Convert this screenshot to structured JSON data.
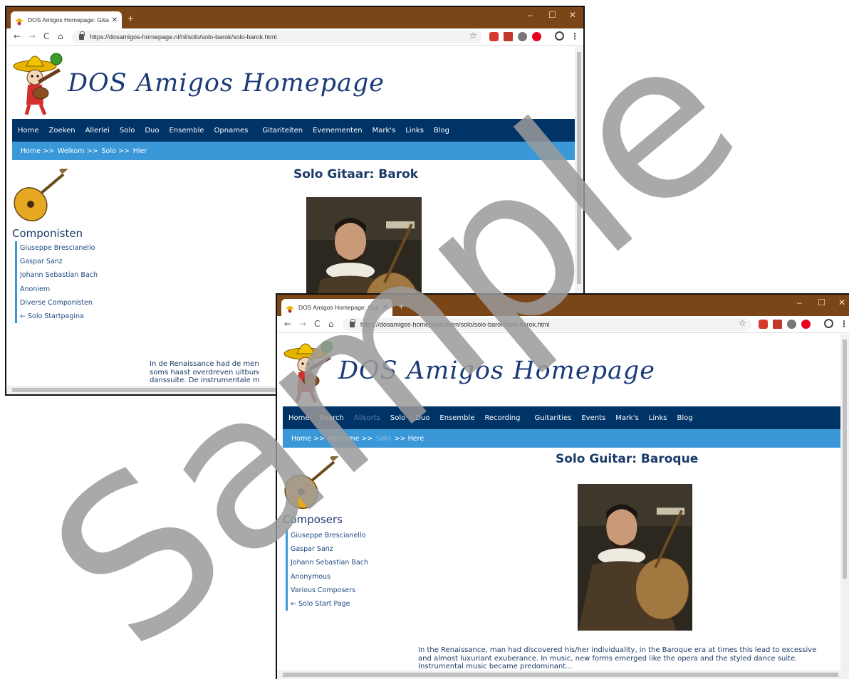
{
  "browser_nl": {
    "tab_title": "DOS Amigos Homepage: Gitaar",
    "tab_close": "✕",
    "new_tab": "+",
    "url": "https://dosamigos-homepage.nl/nl/solo/solo-barok/solo-barok.html"
  },
  "browser_en": {
    "tab_title": "DOS Amigos Homepage: Guitar",
    "tab_close": "✕",
    "new_tab": "+",
    "url": "https://dosamigos-homepage.nl/en/solo/solo-barok/solo-barok.html"
  },
  "window_controls": {
    "minimize": "–",
    "maximize": "☐",
    "close": "✕"
  },
  "toolbar_glyphs": {
    "back": "←",
    "forward": "→",
    "reload": "C",
    "home": "⌂",
    "star": "☆",
    "menu": "⋮"
  },
  "site_title": "DOS Amigos Homepage",
  "page_nl": {
    "nav": [
      "Home",
      "Zoeken",
      "Allerlei",
      "Solo",
      "Duo",
      "Ensemble",
      "Opnames",
      "Gitariteiten",
      "Evenementen",
      "Mark's",
      "Links",
      "Blog"
    ],
    "breadcrumb": [
      "Home >>",
      "Welkom >>",
      "Solo >>",
      "Hier"
    ],
    "heading": "Solo Gitaar: Barok",
    "side_heading": "Componisten",
    "side_links": [
      "Giuseppe Brescianello",
      "Gaspar Sanz",
      "Johann Sebastian Bach",
      "Anoniem",
      "Diverse Componisten",
      "← Solo Startpagina"
    ],
    "body_lines": [
      "In de Renaissance had de mens zie",
      "soms haast overdreven uitbundigh",
      "danssuite. De instrumentale muzie"
    ]
  },
  "page_en": {
    "nav": [
      "Home",
      "Search",
      "Allsorts",
      "Solo",
      "Duo",
      "Ensemble",
      "Recording",
      "Guitarities",
      "Events",
      "Mark's",
      "Links",
      "Blog"
    ],
    "breadcrumb": [
      "Home >>",
      "Welcome >>",
      "Solo",
      ">> Here"
    ],
    "heading": "Solo Guitar: Baroque",
    "side_heading": "Composers",
    "side_links": [
      "Giuseppe Brescianello",
      "Gaspar Sanz",
      "Johann Sebastian Bach",
      "Anonymous",
      "Various Composers",
      "← Solo Start Page"
    ],
    "body_lines": [
      "In the Renaissance, man had discovered his/her individuality, in the Baroque era at times this lead to excessive",
      "and almost luxuriant exuberance. In music, new forms emerged like the opera and the styled dance suite.",
      "Instrumental music became predominant..."
    ]
  },
  "watermark": "Sample",
  "colors": {
    "titlebar": "#7a4617",
    "nav_bg": "#003366",
    "breadcrumb_bg": "#3a98d8",
    "heading": "#1a3a68",
    "watermark": "#9a9a9a"
  }
}
